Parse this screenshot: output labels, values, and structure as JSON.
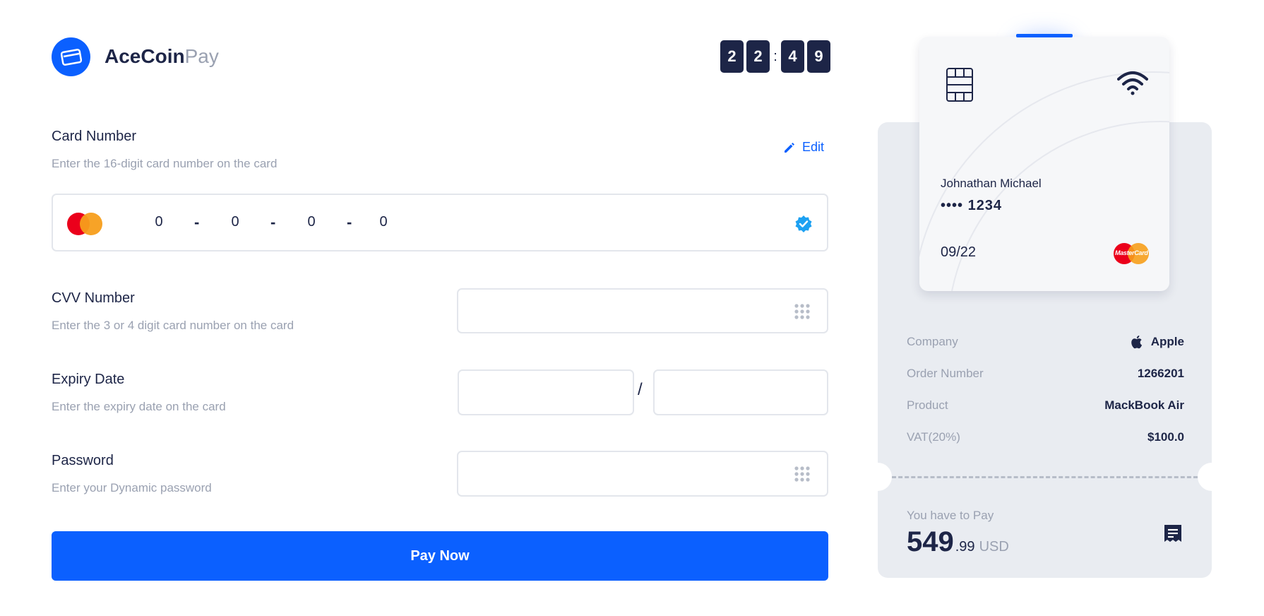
{
  "brand": {
    "name_bold": "AceCoin",
    "name_light": "Pay"
  },
  "timer": {
    "digits": [
      "2",
      "2",
      "4",
      "9"
    ],
    "separator": ":"
  },
  "card_number": {
    "label": "Card Number",
    "help": "Enter the 16-digit card number on the card",
    "edit_label": "Edit",
    "segments": [
      "0",
      "0",
      "0",
      "0"
    ],
    "separator": "-"
  },
  "cvv": {
    "label": "CVV Number",
    "help": "Enter the 3 or 4 digit card number on the card",
    "value": ""
  },
  "expiry": {
    "label": "Expiry Date",
    "help": "Enter the expiry date on the card",
    "month": "",
    "year": "",
    "separator": "/"
  },
  "password": {
    "label": "Password",
    "help": "Enter your Dynamic password",
    "value": ""
  },
  "pay_button": {
    "label": "Pay Now"
  },
  "card_preview": {
    "holder": "Johnathan Michael",
    "number": "•••• 1234",
    "expiry": "09/22",
    "network_logo_text": "MasterCard"
  },
  "summary": {
    "rows": [
      {
        "key": "Company",
        "value": "Apple",
        "icon": "apple-icon"
      },
      {
        "key": "Order Number",
        "value": "1266201"
      },
      {
        "key": "Product",
        "value": "MackBook Air"
      },
      {
        "key": "VAT(20%)",
        "value": "$100.0"
      }
    ],
    "pay_label": "You have to Pay",
    "amount_int": "549",
    "amount_dec": ".99",
    "currency": "USD"
  },
  "colors": {
    "accent": "#0b60ff",
    "navy": "#1d2547",
    "muted": "#9aa1b1",
    "panel": "#e9ecf1"
  }
}
